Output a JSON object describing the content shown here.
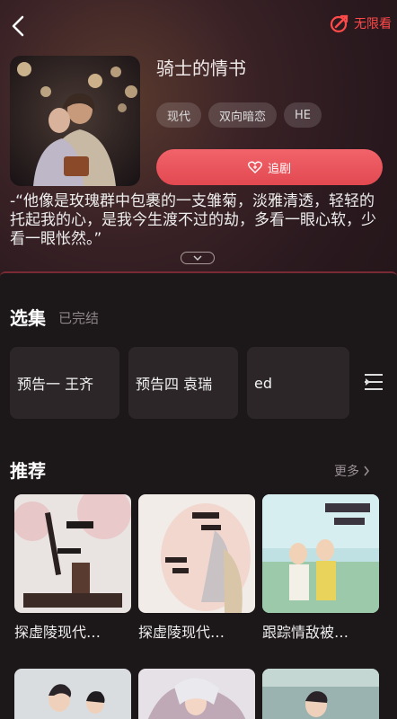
{
  "header": {
    "unlimited_label": "无限看"
  },
  "drama": {
    "title": "骑士的情书",
    "tags": [
      "现代",
      "双向暗恋",
      "HE"
    ],
    "follow_label": "追剧",
    "quote": "-“他像是玫瑰群中包裹的一支雏菊，淡雅清透，轻轻的托起我的心，是我今生渡不过的劫，多看一眼心软，少看一眼怅然。”"
  },
  "episodes": {
    "title": "选集",
    "status": "已完结",
    "items": [
      "预告一 王齐",
      "预告四 袁瑞",
      "ed"
    ]
  },
  "recommend": {
    "title": "推荐",
    "more_label": "更多",
    "items": [
      "探虚陵现代…",
      "探虚陵现代…",
      "跟踪情敌被…"
    ]
  },
  "colors": {
    "accent": "#e8515a",
    "unlimited": "#ff4a4a",
    "panel": "#1c1719"
  }
}
